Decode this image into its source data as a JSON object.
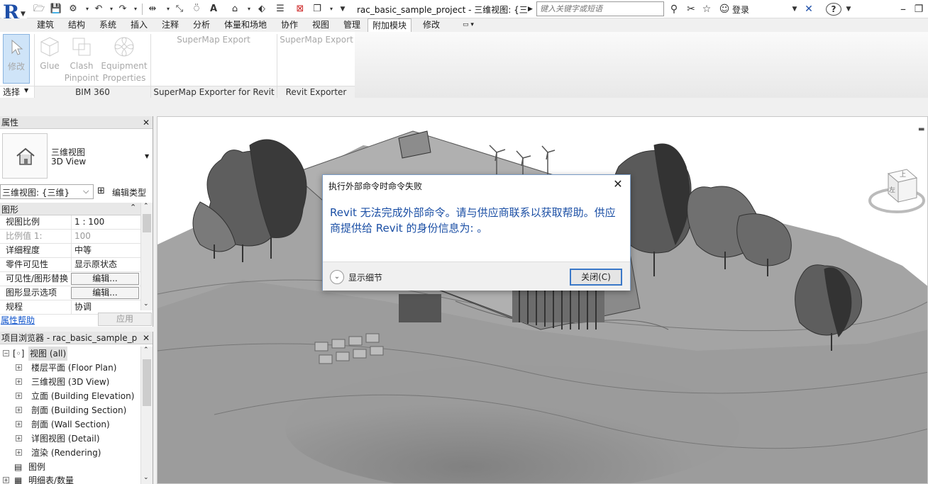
{
  "titlebar": {
    "window_title": "rac_basic_sample_project - 三维视图: {三...",
    "search_placeholder": "键入关键字或短语",
    "login_label": "登录",
    "app_logo_letter": "R",
    "icons": [
      "open-icon",
      "save-icon",
      "sync-icon",
      "undo-icon",
      "redo-icon",
      "measure-icon",
      "dimension-icon",
      "tag-icon",
      "text-icon",
      "3d-view-icon",
      "section-icon",
      "thin-lines-icon",
      "close-hidden-icon",
      "switch-windows-icon",
      "customize-icon",
      "binoculars-icon",
      "subscription-icon",
      "favorites-icon",
      "user-icon",
      "exchange-icon",
      "help-icon",
      "restore-icon"
    ]
  },
  "tabs": [
    "建筑",
    "结构",
    "系统",
    "插入",
    "注释",
    "分析",
    "体量和场地",
    "协作",
    "视图",
    "管理",
    "附加模块",
    "修改"
  ],
  "active_tab": "附加模块",
  "ribbon": {
    "modify_label": "修改",
    "select_label": "选择",
    "glue_label": "Glue",
    "clash_label_1": "Clash",
    "clash_label_2": "Pinpoint",
    "equip_label_1": "Equipment",
    "equip_label_2": "Properties",
    "bim360_label": "BIM 360",
    "supermap_btn_1": "SuperMap Export",
    "supermap_group": "SuperMap Exporter for Revit",
    "supermap_btn_2": "SuperMap Export",
    "revit_exporter_group": "Revit Exporter"
  },
  "properties": {
    "title": "属性",
    "type_name_cn": "三维视图",
    "type_name_en": "3D View",
    "view_selector": "三维视图: {三维}",
    "edit_type": "编辑类型",
    "section": "图形",
    "rows": [
      {
        "k": "视图比例",
        "v": "1 : 100"
      },
      {
        "k": "比例值 1:",
        "v": "100"
      },
      {
        "k": "详细程度",
        "v": "中等"
      },
      {
        "k": "零件可见性",
        "v": "显示原状态"
      },
      {
        "k": "可见性/图形替换",
        "v": "编辑..."
      },
      {
        "k": "图形显示选项",
        "v": "编辑..."
      },
      {
        "k": "规程",
        "v": "协调"
      }
    ],
    "help_link": "属性帮助",
    "apply": "应用"
  },
  "browser": {
    "title": "项目浏览器 - rac_basic_sample_pro...",
    "root": "视图 (all)",
    "items": [
      "楼层平面 (Floor Plan)",
      "三维视图 (3D View)",
      "立面 (Building Elevation)",
      "剖面 (Building Section)",
      "剖面 (Wall Section)",
      "详图视图 (Detail)",
      "渲染 (Rendering)"
    ],
    "legend": "图例",
    "schedules": "明细表/数量"
  },
  "viewcube": {
    "top": "上",
    "left": "左"
  },
  "dialog": {
    "title": "执行外部命令时命令失败",
    "message": "Revit 无法完成外部命令。请与供应商联系以获取帮助。供应商提供给 Revit 的身份信息为: 。",
    "details_label": "显示细节",
    "close_button": "关闭(C)"
  }
}
